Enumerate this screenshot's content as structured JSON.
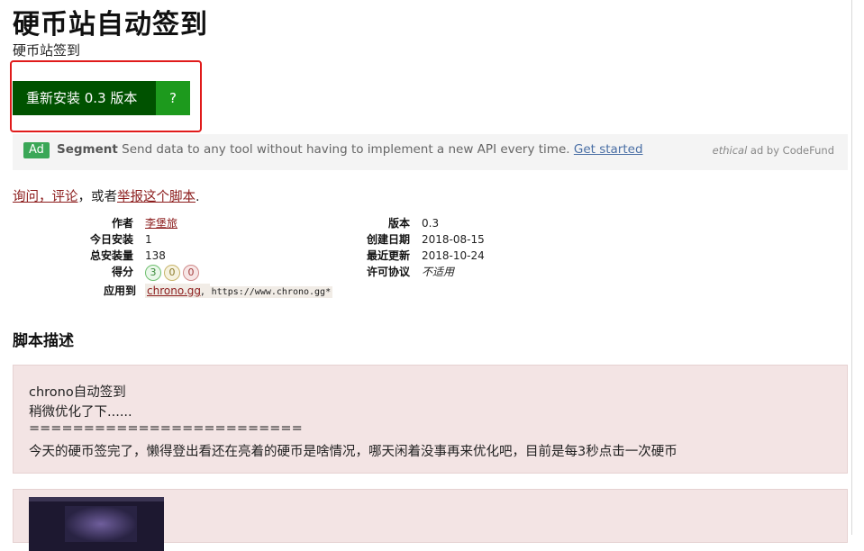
{
  "page": {
    "title": "硬币站自动签到",
    "subtitle": "硬币站签到"
  },
  "install": {
    "label": "重新安装 0.3 版本",
    "help": "?"
  },
  "ad": {
    "badge": "Ad",
    "sponsor": "Segment",
    "text": " Send data to any tool without having to implement a new API every time. ",
    "link": "Get started",
    "credit_italic": "ethical",
    "credit_rest": " ad by CodeFund"
  },
  "feedback": {
    "link1": "询问，评论",
    "mid": "，或者",
    "link2": "举报这个脚本",
    "end": "."
  },
  "meta": {
    "author_label": "作者",
    "author": "李堡旅",
    "daily_label": "今日安装",
    "daily": "1",
    "total_label": "总安装量",
    "total": "138",
    "rating_label": "得分",
    "ratings": {
      "good": "3",
      "ok": "0",
      "bad": "0"
    },
    "applies_label": "应用到",
    "applies_link": "chrono.gg",
    "applies_sep": ", ",
    "applies_url": "https://www.chrono.gg*",
    "version_label": "版本",
    "version": "0.3",
    "created_label": "创建日期",
    "created": "2018-08-15",
    "updated_label": "最近更新",
    "updated": "2018-10-24",
    "license_label": "许可协议",
    "license": "不适用"
  },
  "description": {
    "heading": "脚本描述",
    "lines": [
      "chrono自动签到",
      "稍微优化了下......",
      "=========================",
      "今天的硬币签完了，懒得登出看还在亮着的硬币是啥情况，哪天闲着没事再来优化吧，目前是每3秒点击一次硬币"
    ]
  },
  "colors": {
    "install_main": "#005200",
    "install_help": "#1d9a1d",
    "highlight": "#e01b1b",
    "link": "#8b1b1b",
    "desc_bg": "#f3e4e4"
  }
}
